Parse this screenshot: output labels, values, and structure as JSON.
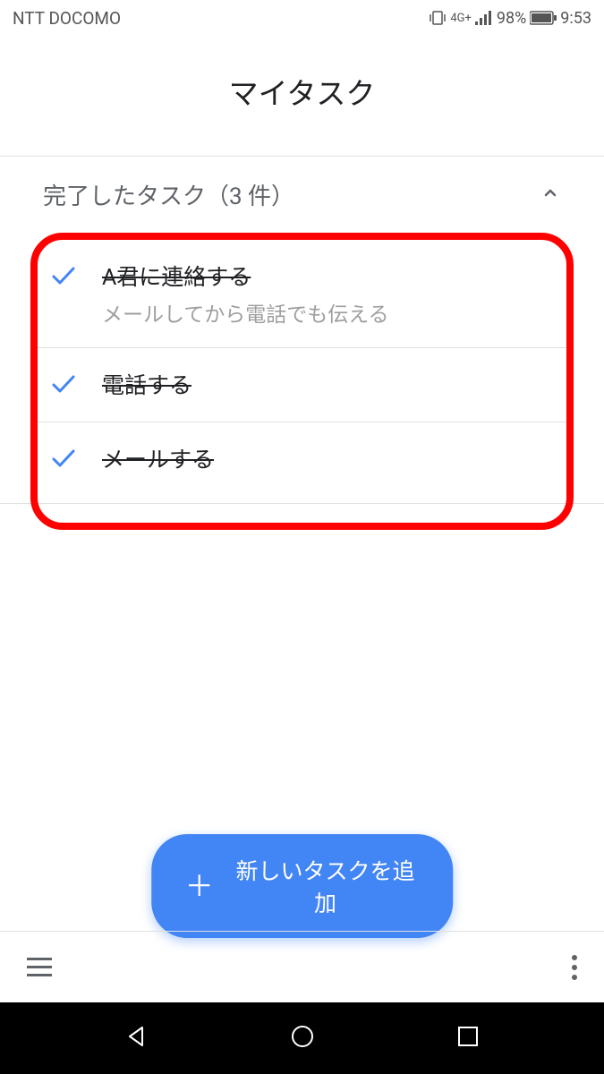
{
  "statusBar": {
    "carrier": "NTT DOCOMO",
    "network": "4G+",
    "battery": "98%",
    "time": "9:53"
  },
  "header": {
    "title": "マイタスク"
  },
  "completedSection": {
    "label": "完了したタスク（3 件）"
  },
  "tasks": [
    {
      "title": "A君に連絡する",
      "subtitle": "メールしてから電話でも伝える"
    },
    {
      "title": "電話する",
      "subtitle": ""
    },
    {
      "title": "メールする",
      "subtitle": ""
    }
  ],
  "fab": {
    "label": "新しいタスクを追加"
  }
}
